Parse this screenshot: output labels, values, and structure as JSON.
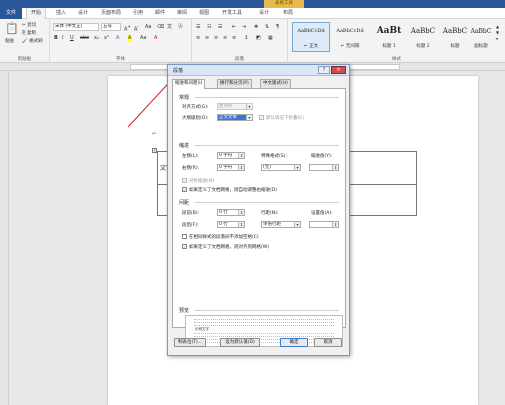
{
  "titlebar": {
    "context_tab": "表格工具"
  },
  "menu": {
    "file": "文件",
    "tabs": [
      "开始",
      "插入",
      "设计",
      "页面布局",
      "引用",
      "邮件",
      "审阅",
      "视图",
      "开发工具",
      "设计",
      "布局"
    ]
  },
  "ribbon": {
    "clipboard": {
      "paste": "粘贴",
      "cut": "剪切",
      "copy": "复制",
      "format_painter": "格式刷",
      "label": "剪贴板"
    },
    "font": {
      "font_name": "宋体 (中文正)",
      "font_size": "五号",
      "label": "字体",
      "buttons": [
        "B",
        "I",
        "U",
        "abc",
        "x₂",
        "x²",
        "A",
        "A",
        "Aa",
        "A"
      ]
    },
    "paragraph": {
      "label": "段落"
    },
    "styles": {
      "label": "样式",
      "items": [
        {
          "sample": "AaBbCcDd",
          "name": "↵ 正文"
        },
        {
          "sample": "AaBbCcDd",
          "name": "↵ 无间隔"
        },
        {
          "sample": "AaBt",
          "name": "标题 1"
        },
        {
          "sample": "AaBbC",
          "name": "标题 2"
        },
        {
          "sample": "AaBbC",
          "name": "标题"
        },
        {
          "sample": "AaBbC",
          "name": "副标题"
        }
      ]
    }
  },
  "document": {
    "cell_text": "文字"
  },
  "dialog": {
    "title": "段落",
    "help": "?",
    "close": "✕",
    "tabs": [
      "缩进和间距(I)",
      "换行和分页(P)",
      "中文版式(H)"
    ],
    "general": {
      "heading": "常规",
      "alignment_label": "对齐方式(G):",
      "alignment_value": "左对齐",
      "outline_label": "大纲级别(O):",
      "outline_value": "正文文本",
      "collapsed_label": "默认情况下折叠(E)"
    },
    "indent": {
      "heading": "缩进",
      "left_label": "左侧(L):",
      "left_value": "0 字符",
      "right_label": "右侧(R):",
      "right_value": "0 字符",
      "special_label": "特殊格式(S):",
      "special_value": "(无)",
      "by_label": "缩进值(Y):",
      "mirror_label": "对称缩进(M)",
      "auto_adjust_label": "如果定义了文档网格，则自动调整右缩进(D)"
    },
    "spacing": {
      "heading": "间距",
      "before_label": "段前(B):",
      "before_value": "0 行",
      "after_label": "段后(F):",
      "after_value": "0 行",
      "line_label": "行距(N):",
      "line_value": "单倍行距",
      "at_label": "设置值(A):",
      "no_space_label": "在相同样式的段落间不添加空格(C)",
      "snap_label": "如果定义了文档网格，则对齐到网格(W)"
    },
    "preview": {
      "heading": "预览",
      "sample": "示例文字"
    },
    "buttons": {
      "tabs": "制表位(T)...",
      "default": "设为默认值(D)",
      "ok": "确定",
      "cancel": "取消"
    }
  }
}
